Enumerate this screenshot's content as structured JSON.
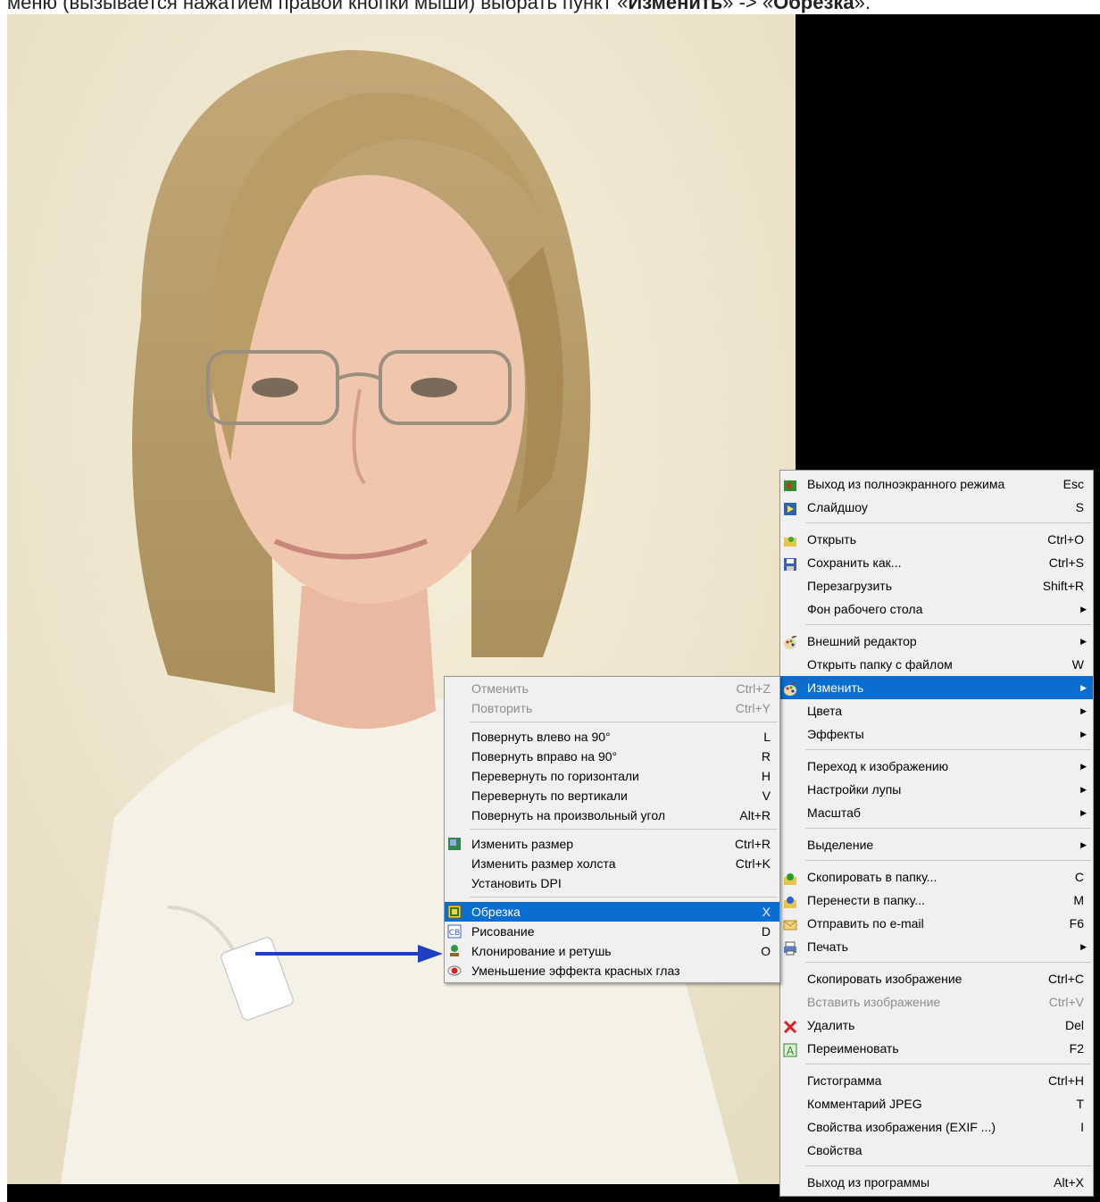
{
  "caption": {
    "prefix": "меню (вызывается нажатием правой кнопки мыши) выбрать пункт «",
    "bold1": "Изменить",
    "middle": "» -> «",
    "bold2": "Обрезка",
    "suffix": "»."
  },
  "main_menu": {
    "groups": [
      [
        {
          "icon": "exit-fullscreen-icon",
          "label": "Выход из полноэкранного режима",
          "shortcut": "Esc"
        },
        {
          "icon": "slideshow-icon",
          "label": "Слайдшоу",
          "shortcut": "S"
        }
      ],
      [
        {
          "icon": "open-folder-icon",
          "label": "Открыть",
          "shortcut": "Ctrl+O"
        },
        {
          "icon": "save-icon",
          "label": "Сохранить как...",
          "shortcut": "Ctrl+S"
        },
        {
          "icon": "",
          "label": "Перезагрузить",
          "shortcut": "Shift+R"
        },
        {
          "icon": "",
          "label": "Фон рабочего стола",
          "shortcut": "",
          "arrow": true
        }
      ],
      [
        {
          "icon": "palette-icon",
          "label": "Внешний редактор",
          "shortcut": "",
          "arrow": true
        },
        {
          "icon": "",
          "label": "Открыть папку с файлом",
          "shortcut": "W"
        },
        {
          "icon": "palette-icon",
          "label": "Изменить",
          "shortcut": "",
          "arrow": true,
          "selected": true
        },
        {
          "icon": "",
          "label": "Цвета",
          "shortcut": "",
          "arrow": true
        },
        {
          "icon": "",
          "label": "Эффекты",
          "shortcut": "",
          "arrow": true
        }
      ],
      [
        {
          "icon": "",
          "label": "Переход к изображению",
          "shortcut": "",
          "arrow": true
        },
        {
          "icon": "",
          "label": "Настройки лупы",
          "shortcut": "",
          "arrow": true
        },
        {
          "icon": "",
          "label": "Масштаб",
          "shortcut": "",
          "arrow": true
        }
      ],
      [
        {
          "icon": "",
          "label": "Выделение",
          "shortcut": "",
          "arrow": true
        }
      ],
      [
        {
          "icon": "copy-to-folder-icon",
          "label": "Скопировать в папку...",
          "shortcut": "C"
        },
        {
          "icon": "move-to-folder-icon",
          "label": "Перенести в папку...",
          "shortcut": "M"
        },
        {
          "icon": "email-icon",
          "label": "Отправить по e-mail",
          "shortcut": "F6"
        },
        {
          "icon": "printer-icon",
          "label": "Печать",
          "shortcut": "",
          "arrow": true
        }
      ],
      [
        {
          "icon": "",
          "label": "Скопировать изображение",
          "shortcut": "Ctrl+C"
        },
        {
          "icon": "",
          "label": "Вставить изображение",
          "shortcut": "Ctrl+V",
          "disabled": true
        },
        {
          "icon": "delete-icon",
          "label": "Удалить",
          "shortcut": "Del"
        },
        {
          "icon": "rename-icon",
          "label": "Переименовать",
          "shortcut": "F2"
        }
      ],
      [
        {
          "icon": "",
          "label": "Гистограмма",
          "shortcut": "Ctrl+H"
        },
        {
          "icon": "",
          "label": "Комментарий JPEG",
          "shortcut": "T"
        },
        {
          "icon": "",
          "label": "Свойства изображения (EXIF ...)",
          "shortcut": "I"
        },
        {
          "icon": "",
          "label": "Свойства",
          "shortcut": ""
        }
      ],
      [
        {
          "icon": "",
          "label": "Выход из программы",
          "shortcut": "Alt+X"
        }
      ]
    ]
  },
  "sub_menu": {
    "groups": [
      [
        {
          "icon": "",
          "label": "Отменить",
          "shortcut": "Ctrl+Z",
          "disabled": true
        },
        {
          "icon": "",
          "label": "Повторить",
          "shortcut": "Ctrl+Y",
          "disabled": true
        }
      ],
      [
        {
          "icon": "",
          "label": "Повернуть влево на 90°",
          "shortcut": "L"
        },
        {
          "icon": "",
          "label": "Повернуть вправо на 90°",
          "shortcut": "R"
        },
        {
          "icon": "",
          "label": "Перевернуть по горизонтали",
          "shortcut": "H"
        },
        {
          "icon": "",
          "label": "Перевернуть по вертикали",
          "shortcut": "V"
        },
        {
          "icon": "",
          "label": "Повернуть на произвольный угол",
          "shortcut": "Alt+R"
        }
      ],
      [
        {
          "icon": "resize-icon",
          "label": "Изменить размер",
          "shortcut": "Ctrl+R"
        },
        {
          "icon": "",
          "label": "Изменить размер холста",
          "shortcut": "Ctrl+K"
        },
        {
          "icon": "",
          "label": "Установить DPI",
          "shortcut": ""
        }
      ],
      [
        {
          "icon": "crop-icon",
          "label": "Обрезка",
          "shortcut": "X",
          "selected": true
        },
        {
          "icon": "paint-icon",
          "label": "Рисование",
          "shortcut": "D"
        },
        {
          "icon": "clone-stamp-icon",
          "label": "Клонирование и ретушь",
          "shortcut": "O"
        },
        {
          "icon": "red-eye-icon",
          "label": "Уменьшение эффекта красных глаз",
          "shortcut": ""
        }
      ]
    ]
  },
  "colors": {
    "selection": "#0a6ed1",
    "arrow": "#1f3fbf",
    "menu_bg": "#f0f0f0"
  }
}
